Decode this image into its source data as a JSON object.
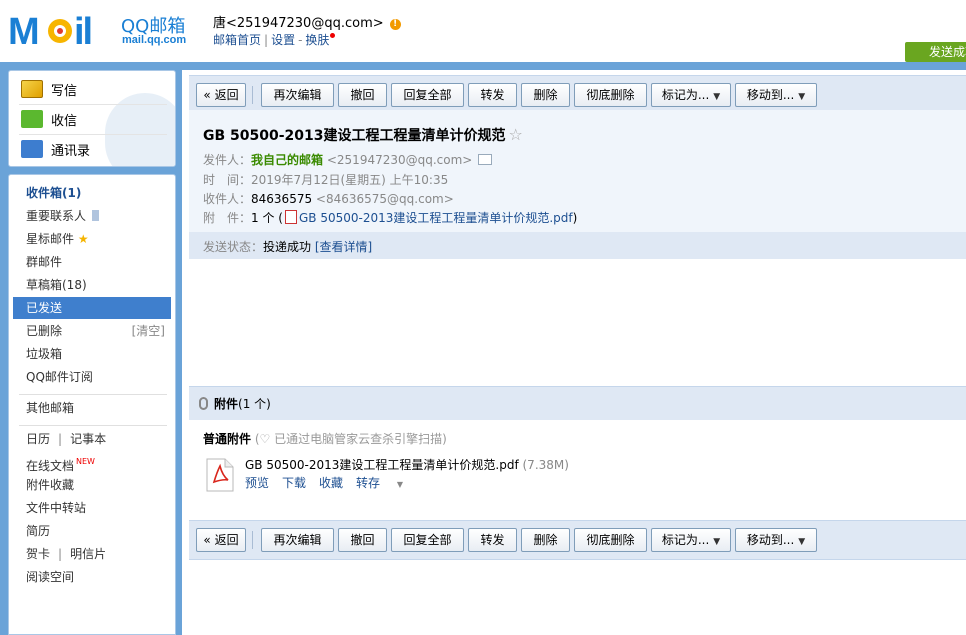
{
  "header": {
    "logo_text": "QQ邮箱",
    "logo_sub": "mail.qq.com",
    "user": "唐<251947230@qq.com>",
    "links": {
      "home": "邮箱首页",
      "settings": "设置",
      "skin": "换肤"
    },
    "send_status_badge": "发送成功"
  },
  "sidebar_top": {
    "compose": "写信",
    "receive": "收信",
    "contacts": "通讯录"
  },
  "nav": {
    "inbox": "收件箱(1)",
    "important": "重要联系人",
    "starred": "星标邮件",
    "group": "群邮件",
    "drafts": "草稿箱(18)",
    "sent": "已发送",
    "deleted": "已删除",
    "clear": "[清空]",
    "spam": "垃圾箱",
    "subscriptions": "QQ邮件订阅",
    "other": "其他邮箱",
    "calendar": "日历",
    "notes": "记事本",
    "docs": "在线文档",
    "docs_badge": "NEW",
    "attach_fav": "附件收藏",
    "transfer": "文件中转站",
    "resume": "简历",
    "card": "贺卡",
    "postcard": "明信片",
    "reading": "阅读空间"
  },
  "toolbar": {
    "back": "« 返回",
    "reedit": "再次编辑",
    "recall": "撤回",
    "reply_all": "回复全部",
    "forward": "转发",
    "delete": "删除",
    "perm_delete": "彻底删除",
    "mark_as": "标记为...",
    "move_to": "移动到..."
  },
  "mail": {
    "subject": "GB 50500-2013建设工程工程量清单计价规范",
    "from_label": "发件人：",
    "from_name": "我自己的邮箱",
    "from_addr": "<251947230@qq.com>",
    "time_label": "时　间：",
    "time": "2019年7月12日(星期五) 上午10:35",
    "to_label": "收件人：",
    "to_name": "84636575",
    "to_addr": "<84636575@qq.com>",
    "att_label": "附　件：",
    "att_count": "1 个 (",
    "att_file": "GB 50500-2013建设工程工程量清单计价规范.pdf",
    "att_close": ")",
    "status_label": "发送状态：",
    "status_value": "投递成功",
    "status_link": "[查看详情]"
  },
  "attachments": {
    "title": "附件",
    "count": "(1 个)",
    "normal_label": "普通附件",
    "scan_note": "(♡ 已通过电脑管家云查杀引擎扫描)",
    "file_name": "GB 50500-2013建设工程工程量清单计价规范.pdf",
    "file_size": "(7.38M)",
    "actions": {
      "preview": "预览",
      "download": "下载",
      "favorite": "收藏",
      "save": "转存"
    }
  },
  "colors": {
    "accent": "#3f7fcd",
    "frame": "#6aa3d8",
    "toolbar_bg": "#dfe8f4",
    "success": "#6aa620"
  }
}
